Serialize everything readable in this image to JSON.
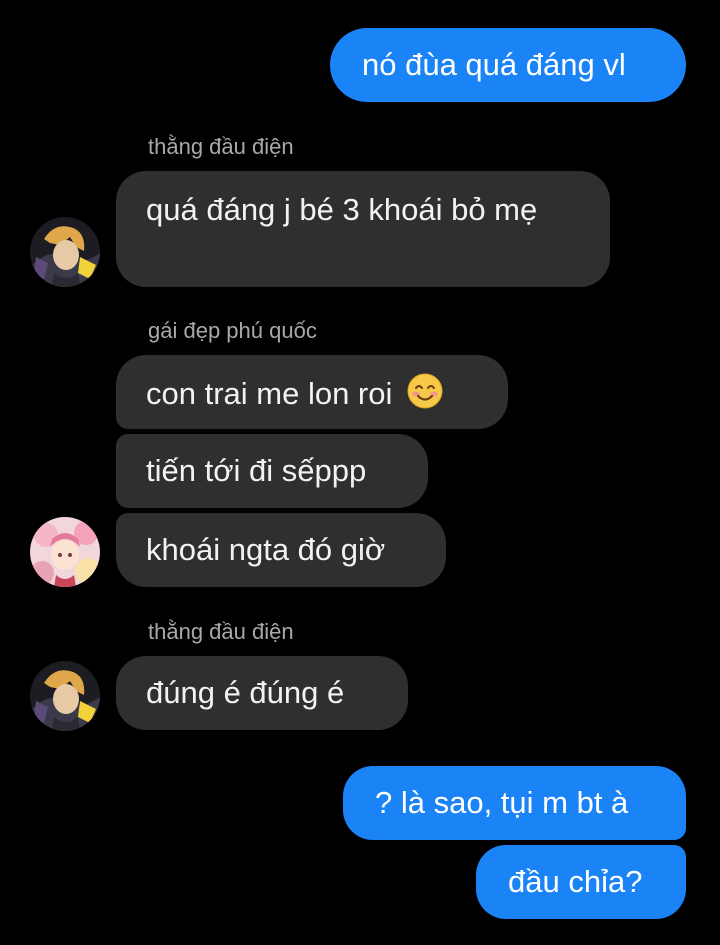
{
  "conversation": {
    "messages": [
      {
        "id": "m1",
        "direction": "outgoing",
        "text": "nó đùa quá đáng vl"
      },
      {
        "id": "m2",
        "direction": "incoming",
        "sender": "thằng đầu điện",
        "text": "quá đáng j bé 3 khoái bỏ mẹ"
      },
      {
        "id": "m3",
        "direction": "incoming",
        "sender": "gái đẹp phú quốc",
        "text": "con trai me lon roi",
        "emoji": "smiling-face-emoji"
      },
      {
        "id": "m4",
        "direction": "incoming",
        "text": "tiến tới đi sếppp"
      },
      {
        "id": "m5",
        "direction": "incoming",
        "text": "khoái ngta đó giờ"
      },
      {
        "id": "m6",
        "direction": "incoming",
        "sender": "thằng đầu điện",
        "text": "đúng é đúng é"
      },
      {
        "id": "m7",
        "direction": "outgoing",
        "text": "? là sao, tụi m bt à"
      },
      {
        "id": "m8",
        "direction": "outgoing",
        "text": "đầu chỉa?"
      }
    ]
  },
  "colors": {
    "background": "#000000",
    "outgoing_bubble": "#1a83f5",
    "incoming_bubble": "#2f2f2f",
    "sender_name": "#a8a8a8"
  }
}
